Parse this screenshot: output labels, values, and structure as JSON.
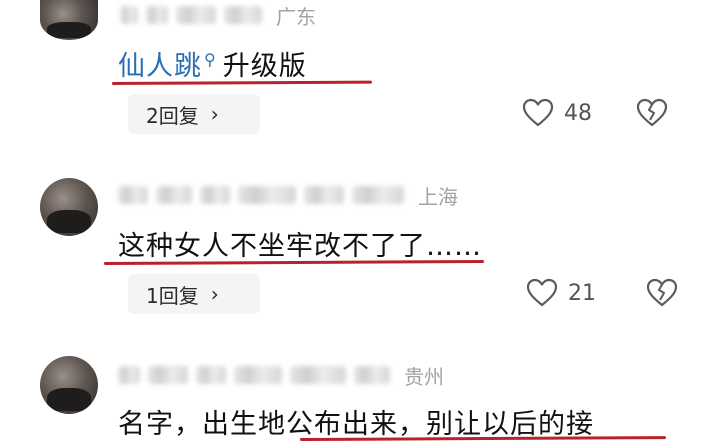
{
  "comments": [
    {
      "region": "广东",
      "text": "仙人跳",
      "search_icon": "search-icon",
      "suffix": "升级版",
      "replies": "2回复",
      "likes": "48"
    },
    {
      "region": "上海",
      "text": "这种女人不坐牢改不了了……",
      "replies": "1回复",
      "likes": "21"
    },
    {
      "region": "贵州",
      "text": "名字，出生地公布出来，别让以后的接"
    }
  ],
  "icons": {
    "like": "heart-outline-icon",
    "dislike": "broken-heart-icon",
    "chevron": "chevron-right-icon"
  },
  "colors": {
    "link": "#2b6fb2",
    "underline": "#b7222b",
    "meta": "#a3a3a3"
  }
}
